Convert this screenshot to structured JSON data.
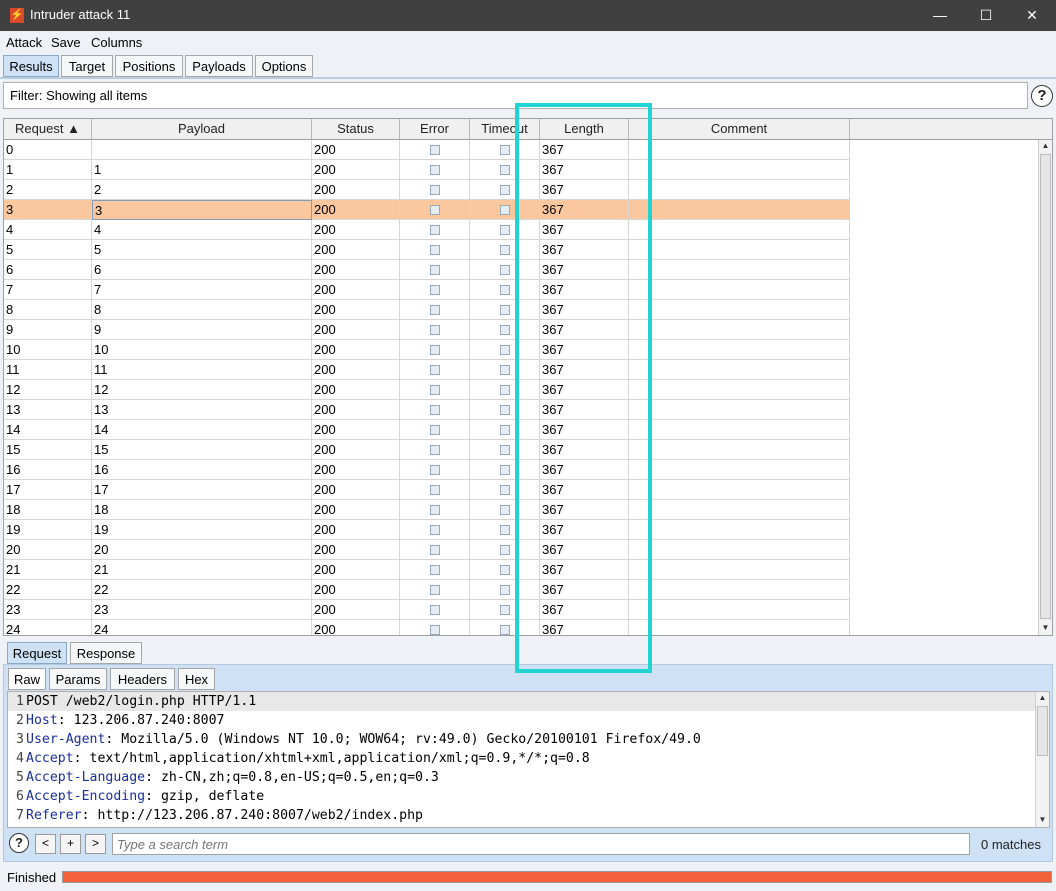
{
  "window": {
    "title": "Intruder attack 11",
    "minimize": "—",
    "maximize": "☐",
    "close": "✕"
  },
  "menu": [
    "Attack",
    "Save",
    "Columns"
  ],
  "main_tabs": [
    "Results",
    "Target",
    "Positions",
    "Payloads",
    "Options"
  ],
  "filter": {
    "text": "Filter: Showing all items",
    "help": "?"
  },
  "table": {
    "columns": [
      "Request ▲",
      "Payload",
      "Status",
      "Error",
      "Timeout",
      "Length",
      "Comment"
    ],
    "selected_row": 3,
    "rows": [
      [
        "0",
        "",
        "200",
        "367"
      ],
      [
        "1",
        "1",
        "200",
        "367"
      ],
      [
        "2",
        "2",
        "200",
        "367"
      ],
      [
        "3",
        "3",
        "200",
        "367"
      ],
      [
        "4",
        "4",
        "200",
        "367"
      ],
      [
        "5",
        "5",
        "200",
        "367"
      ],
      [
        "6",
        "6",
        "200",
        "367"
      ],
      [
        "7",
        "7",
        "200",
        "367"
      ],
      [
        "8",
        "8",
        "200",
        "367"
      ],
      [
        "9",
        "9",
        "200",
        "367"
      ],
      [
        "10",
        "10",
        "200",
        "367"
      ],
      [
        "11",
        "11",
        "200",
        "367"
      ],
      [
        "12",
        "12",
        "200",
        "367"
      ],
      [
        "13",
        "13",
        "200",
        "367"
      ],
      [
        "14",
        "14",
        "200",
        "367"
      ],
      [
        "15",
        "15",
        "200",
        "367"
      ],
      [
        "16",
        "16",
        "200",
        "367"
      ],
      [
        "17",
        "17",
        "200",
        "367"
      ],
      [
        "18",
        "18",
        "200",
        "367"
      ],
      [
        "19",
        "19",
        "200",
        "367"
      ],
      [
        "20",
        "20",
        "200",
        "367"
      ],
      [
        "21",
        "21",
        "200",
        "367"
      ],
      [
        "22",
        "22",
        "200",
        "367"
      ],
      [
        "23",
        "23",
        "200",
        "367"
      ],
      [
        "24",
        "24",
        "200",
        "367"
      ]
    ]
  },
  "detail_tabs": [
    "Request",
    "Response"
  ],
  "view_tabs": [
    "Raw",
    "Params",
    "Headers",
    "Hex"
  ],
  "request_lines": [
    {
      "n": "1",
      "key": "",
      "val": "POST /web2/login.php HTTP/1.1"
    },
    {
      "n": "2",
      "key": "Host",
      "val": ": 123.206.87.240:8007"
    },
    {
      "n": "3",
      "key": "User-Agent",
      "val": ": Mozilla/5.0 (Windows NT 10.0; WOW64; rv:49.0) Gecko/20100101 Firefox/49.0"
    },
    {
      "n": "4",
      "key": "Accept",
      "val": ": text/html,application/xhtml+xml,application/xml;q=0.9,*/*;q=0.8"
    },
    {
      "n": "5",
      "key": "Accept-Language",
      "val": ": zh-CN,zh;q=0.8,en-US;q=0.5,en;q=0.3"
    },
    {
      "n": "6",
      "key": "Accept-Encoding",
      "val": ": gzip, deflate"
    },
    {
      "n": "7",
      "key": "Referer",
      "val": ": http://123.206.87.240:8007/web2/index.php"
    }
  ],
  "search": {
    "placeholder": "Type a search term",
    "matches": "0 matches",
    "help": "?",
    "prev": "<",
    "add": "+",
    "next": ">"
  },
  "status": {
    "text": "Finished",
    "progress": 1.0,
    "progress_color": "#f2613a"
  },
  "highlight_color": "#22d3d3"
}
